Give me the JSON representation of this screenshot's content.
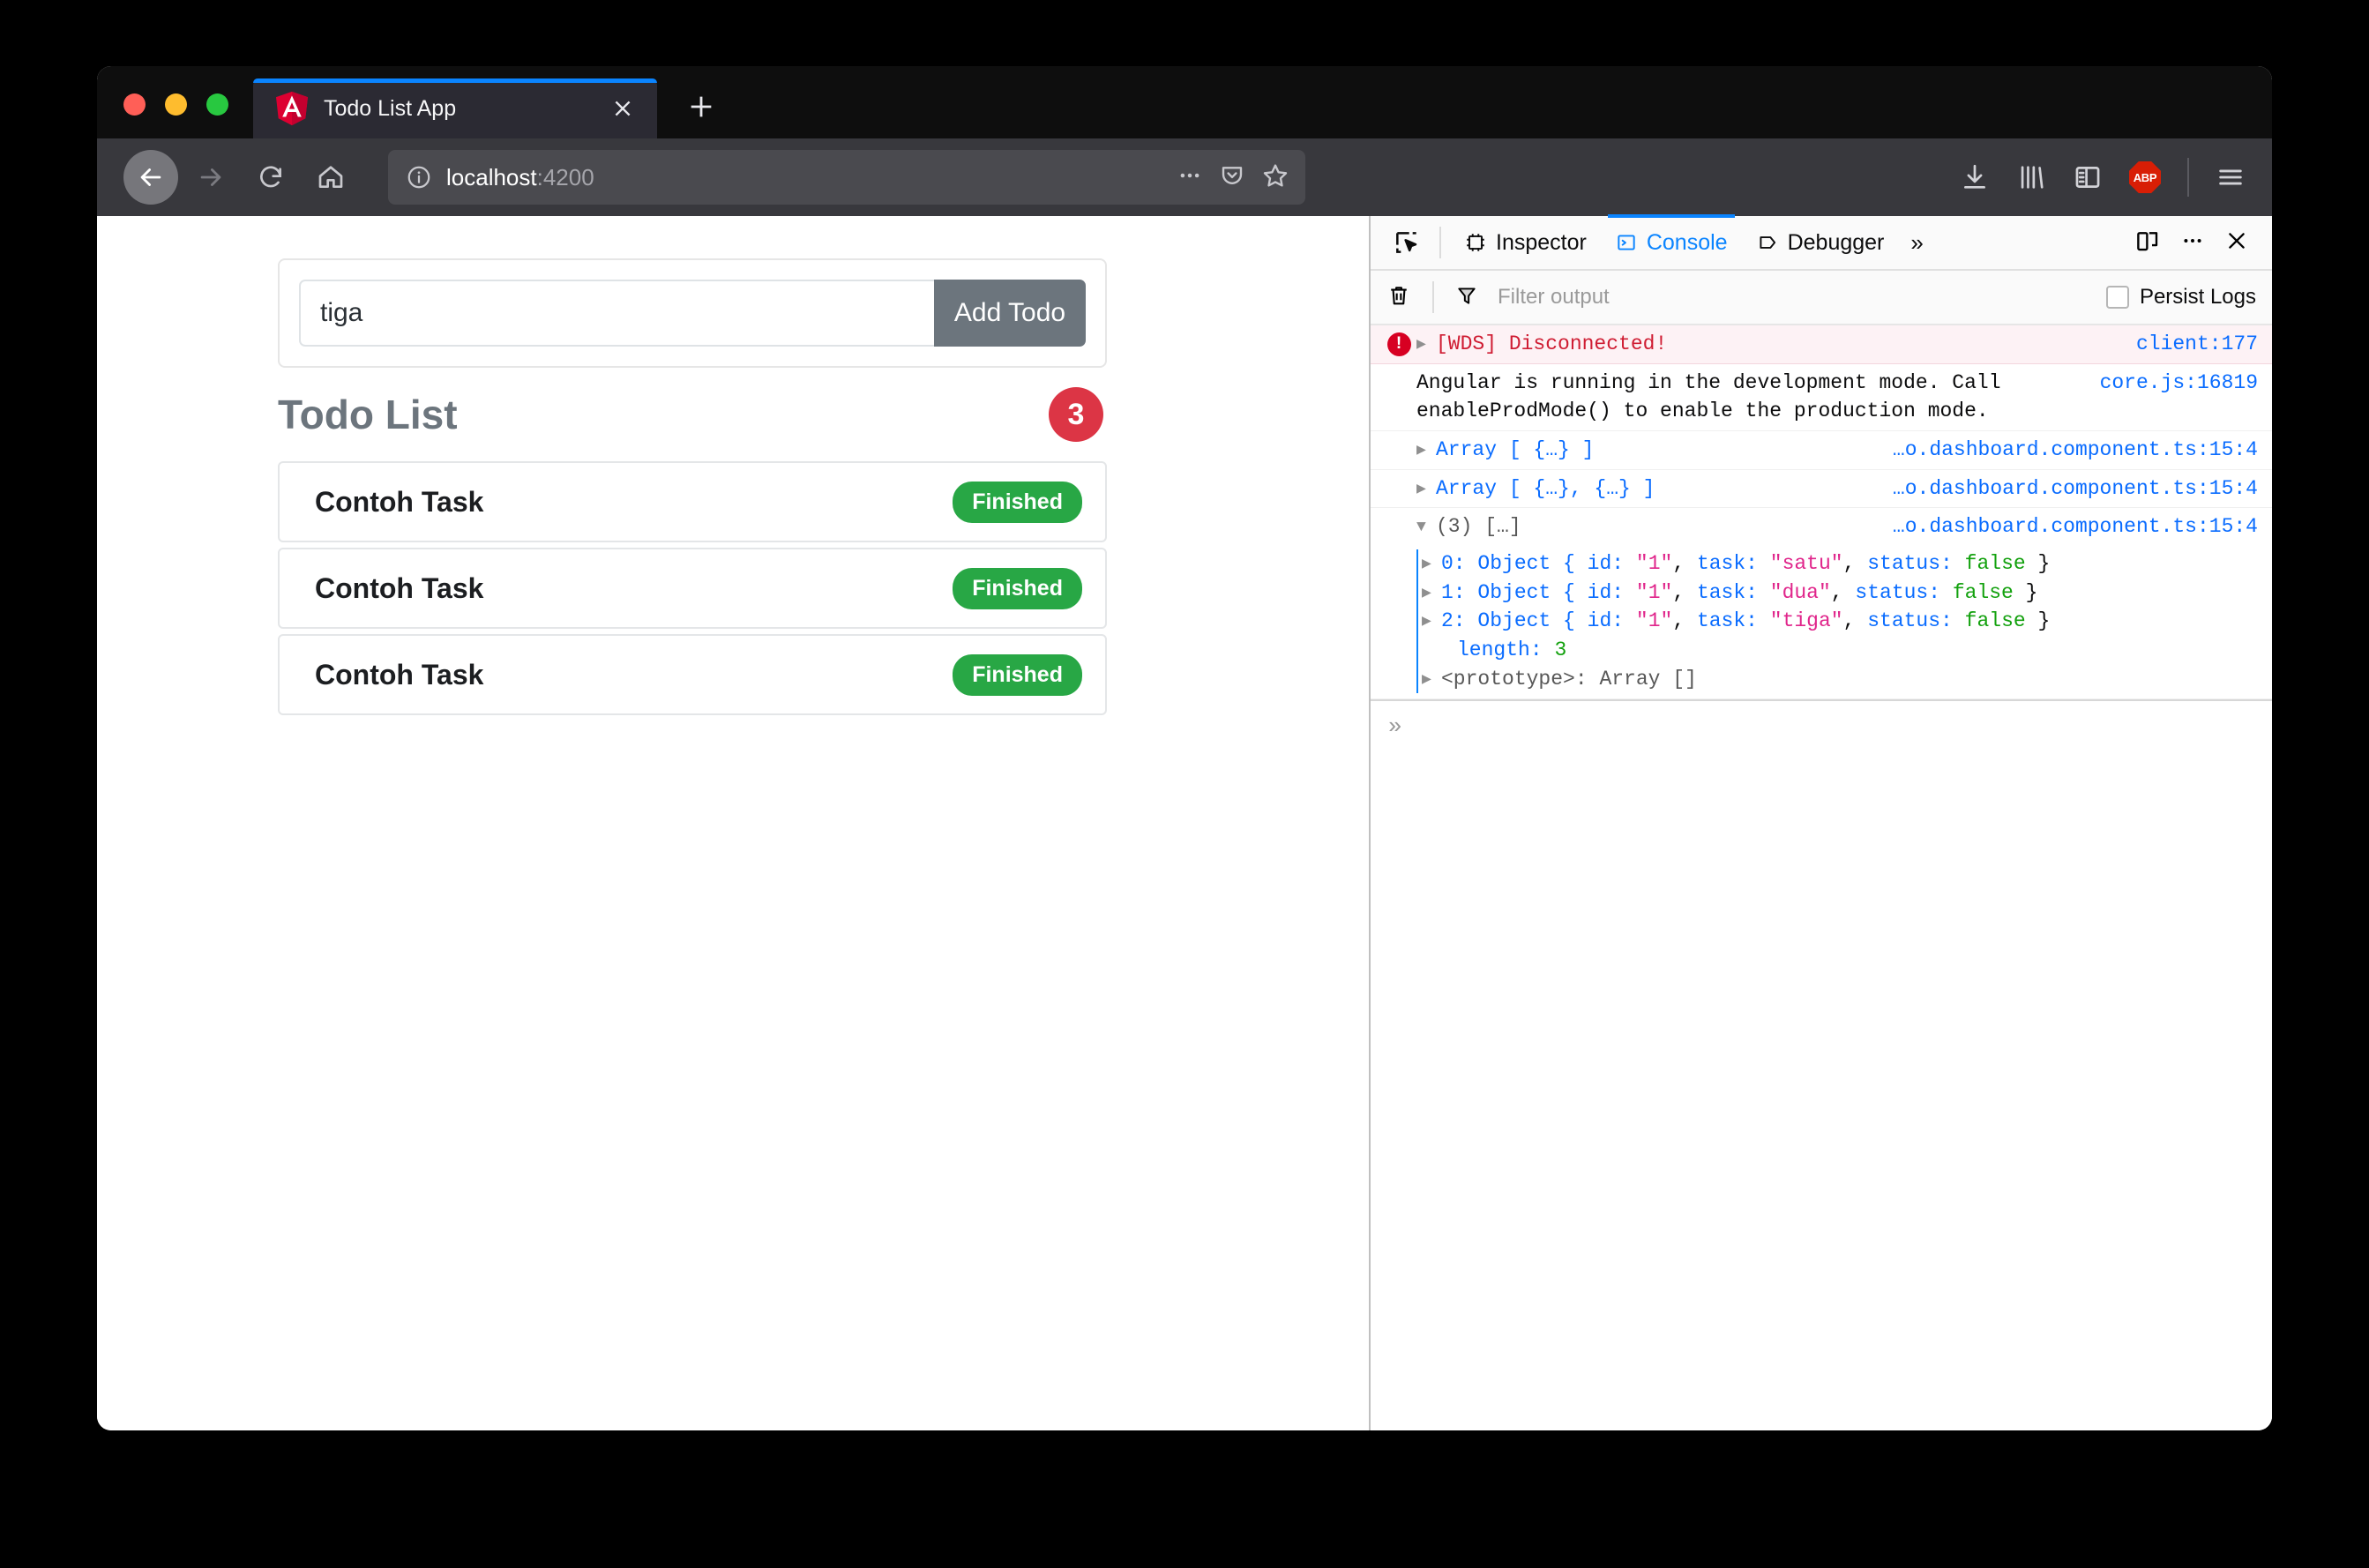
{
  "browser": {
    "traffic_lights": [
      "close",
      "minimize",
      "maximize"
    ],
    "tab": {
      "title": "Todo List App",
      "favicon": "angular-logo",
      "close_label": "✕"
    },
    "new_tab_label": "+",
    "nav": {
      "back": "back-arrow",
      "forward": "forward-arrow",
      "reload": "reload-icon",
      "home": "home-icon"
    },
    "url": {
      "host": "localhost",
      "port": ":4200",
      "info_icon": "info-circle-icon"
    },
    "url_actions": [
      "ellipsis-icon",
      "pocket-icon",
      "bookmark-star-icon"
    ],
    "toolbar_right": [
      "download-icon",
      "library-icon",
      "sidebar-icon",
      "adblock-plus-icon",
      "hamburger-menu-icon"
    ],
    "adblock_label": "ABP"
  },
  "app": {
    "input": {
      "value": "tiga",
      "placeholder": ""
    },
    "add_button": "Add Todo",
    "list_title": "Todo List",
    "count_badge": "3",
    "todos": [
      {
        "name": "Contoh Task",
        "status": "Finished"
      },
      {
        "name": "Contoh Task",
        "status": "Finished"
      },
      {
        "name": "Contoh Task",
        "status": "Finished"
      }
    ]
  },
  "devtools": {
    "tabs": [
      {
        "label": "Inspector",
        "icon": "inspector-icon",
        "active": false
      },
      {
        "label": "Console",
        "icon": "console-icon",
        "active": true
      },
      {
        "label": "Debugger",
        "icon": "debugger-icon",
        "active": false
      }
    ],
    "overflow_label": "»",
    "picker_icon": "element-picker-icon",
    "right_icons": [
      "responsive-mode-icon",
      "meatball-menu-icon",
      "close-icon"
    ],
    "filter": {
      "placeholder": "Filter output",
      "trash_icon": "trash-icon",
      "funnel_icon": "funnel-icon"
    },
    "persist_logs": {
      "label": "Persist Logs",
      "checked": false
    },
    "console": {
      "rows": [
        {
          "kind": "error",
          "text": "[WDS] Disconnected!",
          "source": "client:177"
        },
        {
          "kind": "log",
          "text": "Angular is running in the development mode. Call enableProdMode() to enable the production mode.",
          "source": "core.js:16819"
        },
        {
          "kind": "array",
          "text": "Array [ {…} ]",
          "source": "…o.dashboard.component.ts:15:4"
        },
        {
          "kind": "array",
          "text": "Array [ {…}, {…} ]",
          "source": "…o.dashboard.component.ts:15:4"
        },
        {
          "kind": "array-open",
          "text": "(3) […]",
          "source": "…o.dashboard.component.ts:15:4"
        }
      ],
      "expanded": {
        "items": [
          {
            "index": "0:",
            "type": "Object {",
            "key_id": "id:",
            "val_id": "\"1\"",
            "key_task": "task:",
            "val_task": "\"satu\"",
            "key_status": "status:",
            "val_status": "false",
            "close": "}"
          },
          {
            "index": "1:",
            "type": "Object {",
            "key_id": "id:",
            "val_id": "\"1\"",
            "key_task": "task:",
            "val_task": "\"dua\"",
            "key_status": "status:",
            "val_status": "false",
            "close": "}"
          },
          {
            "index": "2:",
            "type": "Object {",
            "key_id": "id:",
            "val_id": "\"1\"",
            "key_task": "task:",
            "val_task": "\"tiga\"",
            "key_status": "status:",
            "val_status": "false",
            "close": "}"
          }
        ],
        "length_key": "length:",
        "length_val": "3",
        "prototype_key": "<prototype>:",
        "prototype_val": "Array []"
      },
      "prompt": "»"
    }
  },
  "colors": {
    "accent_blue": "#0a84ff",
    "error_red": "#d70022",
    "badge_red": "#dc3545",
    "success_green": "#28a745",
    "button_gray": "#6c757d",
    "string_magenta": "#e0258b"
  }
}
